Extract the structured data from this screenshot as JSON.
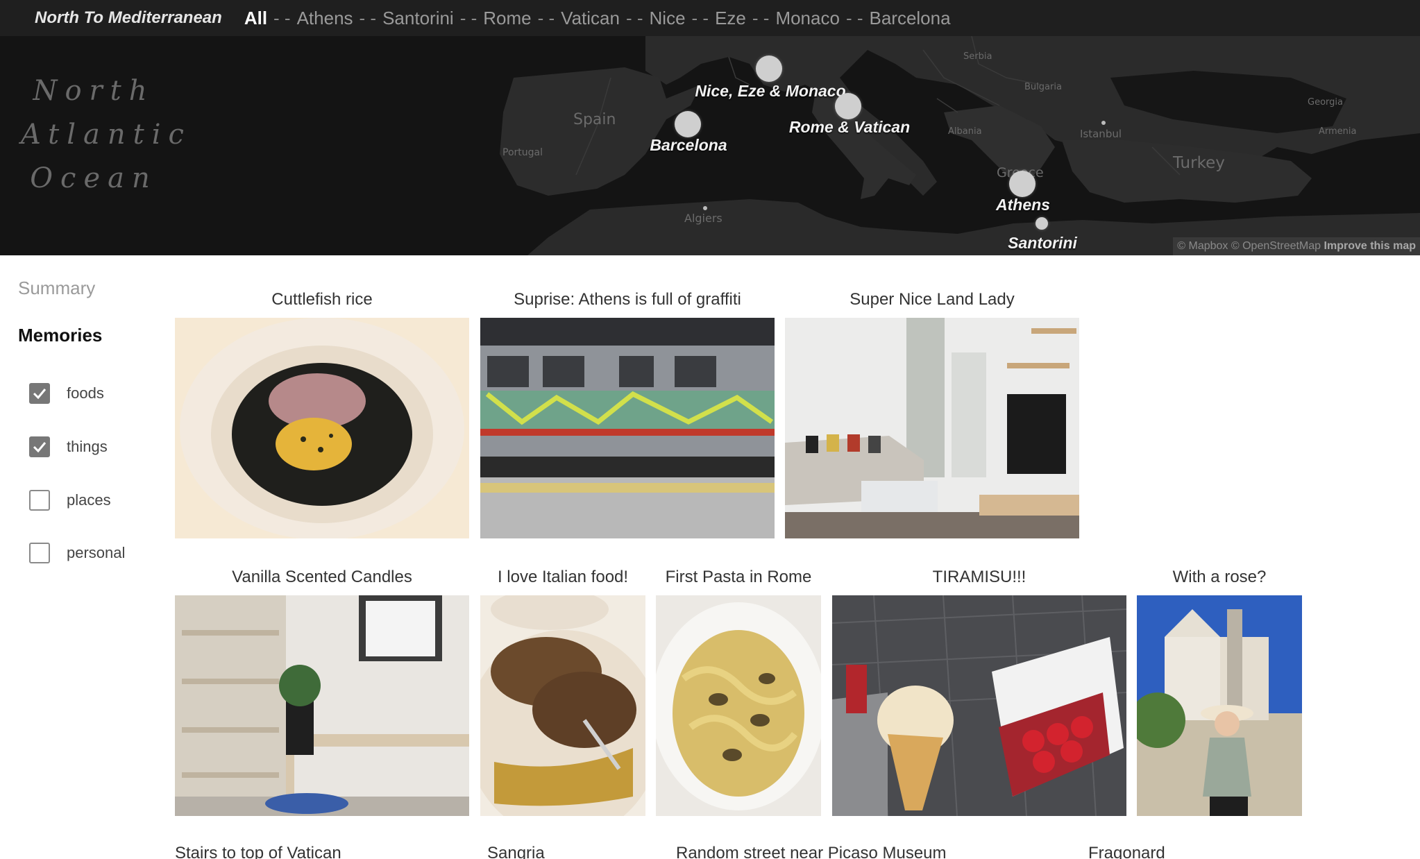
{
  "nav": {
    "brand": "North To Mediterranean",
    "items": [
      {
        "label": "All",
        "active": true
      },
      {
        "label": "Athens"
      },
      {
        "label": "Santorini"
      },
      {
        "label": "Rome"
      },
      {
        "label": "Vatican"
      },
      {
        "label": "Nice"
      },
      {
        "label": "Eze"
      },
      {
        "label": "Monaco"
      },
      {
        "label": "Barcelona"
      }
    ],
    "separator": "- -"
  },
  "map": {
    "ocean_lines": [
      "North",
      "Atlantic",
      "Ocean"
    ],
    "region_labels": [
      "Spain",
      "Portugal",
      "Algiers",
      "Serbia",
      "Bulgaria",
      "Albania",
      "Istanbul",
      "Greece",
      "Turkey",
      "Georgia",
      "Armenia"
    ],
    "markers": [
      {
        "label": "Nice, Eze & Monaco"
      },
      {
        "label": "Barcelona"
      },
      {
        "label": "Rome & Vatican"
      },
      {
        "label": "Athens"
      },
      {
        "label": "Santorini"
      }
    ],
    "attribution": "© Mapbox © OpenStreetMap",
    "attribution_link": "Improve this map"
  },
  "sidebar": {
    "summary": "Summary",
    "memories": "Memories",
    "filters": [
      {
        "label": "foods",
        "checked": true
      },
      {
        "label": "things",
        "checked": true
      },
      {
        "label": "places",
        "checked": false
      },
      {
        "label": "personal",
        "checked": false
      }
    ]
  },
  "gallery": {
    "row1": [
      {
        "title": "Cuttlefish rice",
        "icon": "food-photo"
      },
      {
        "title": "Suprise: Athens is full of graffiti",
        "icon": "train-photo"
      },
      {
        "title": "Super Nice Land Lady",
        "icon": "room-photo"
      }
    ],
    "row2": [
      {
        "title": "Vanilla Scented Candles",
        "icon": "shelf-photo"
      },
      {
        "title": "I love Italian food!",
        "icon": "food-photo"
      },
      {
        "title": "First Pasta in Rome",
        "icon": "pasta-photo"
      },
      {
        "title": "TIRAMISU!!!",
        "icon": "dessert-photo"
      },
      {
        "title": "With a rose?",
        "icon": "portrait-photo"
      }
    ],
    "row3": [
      {
        "title": "Stairs to top of Vatican"
      },
      {
        "title": "Sangria"
      },
      {
        "title": "Random street near Picaso Museum"
      },
      {
        "title": "Fragonard"
      }
    ]
  },
  "colors": {
    "nav_bg": "#1f1f1f",
    "map_bg": "#141414",
    "land": "#2c2c2c",
    "marker": "#cfcfcf"
  }
}
